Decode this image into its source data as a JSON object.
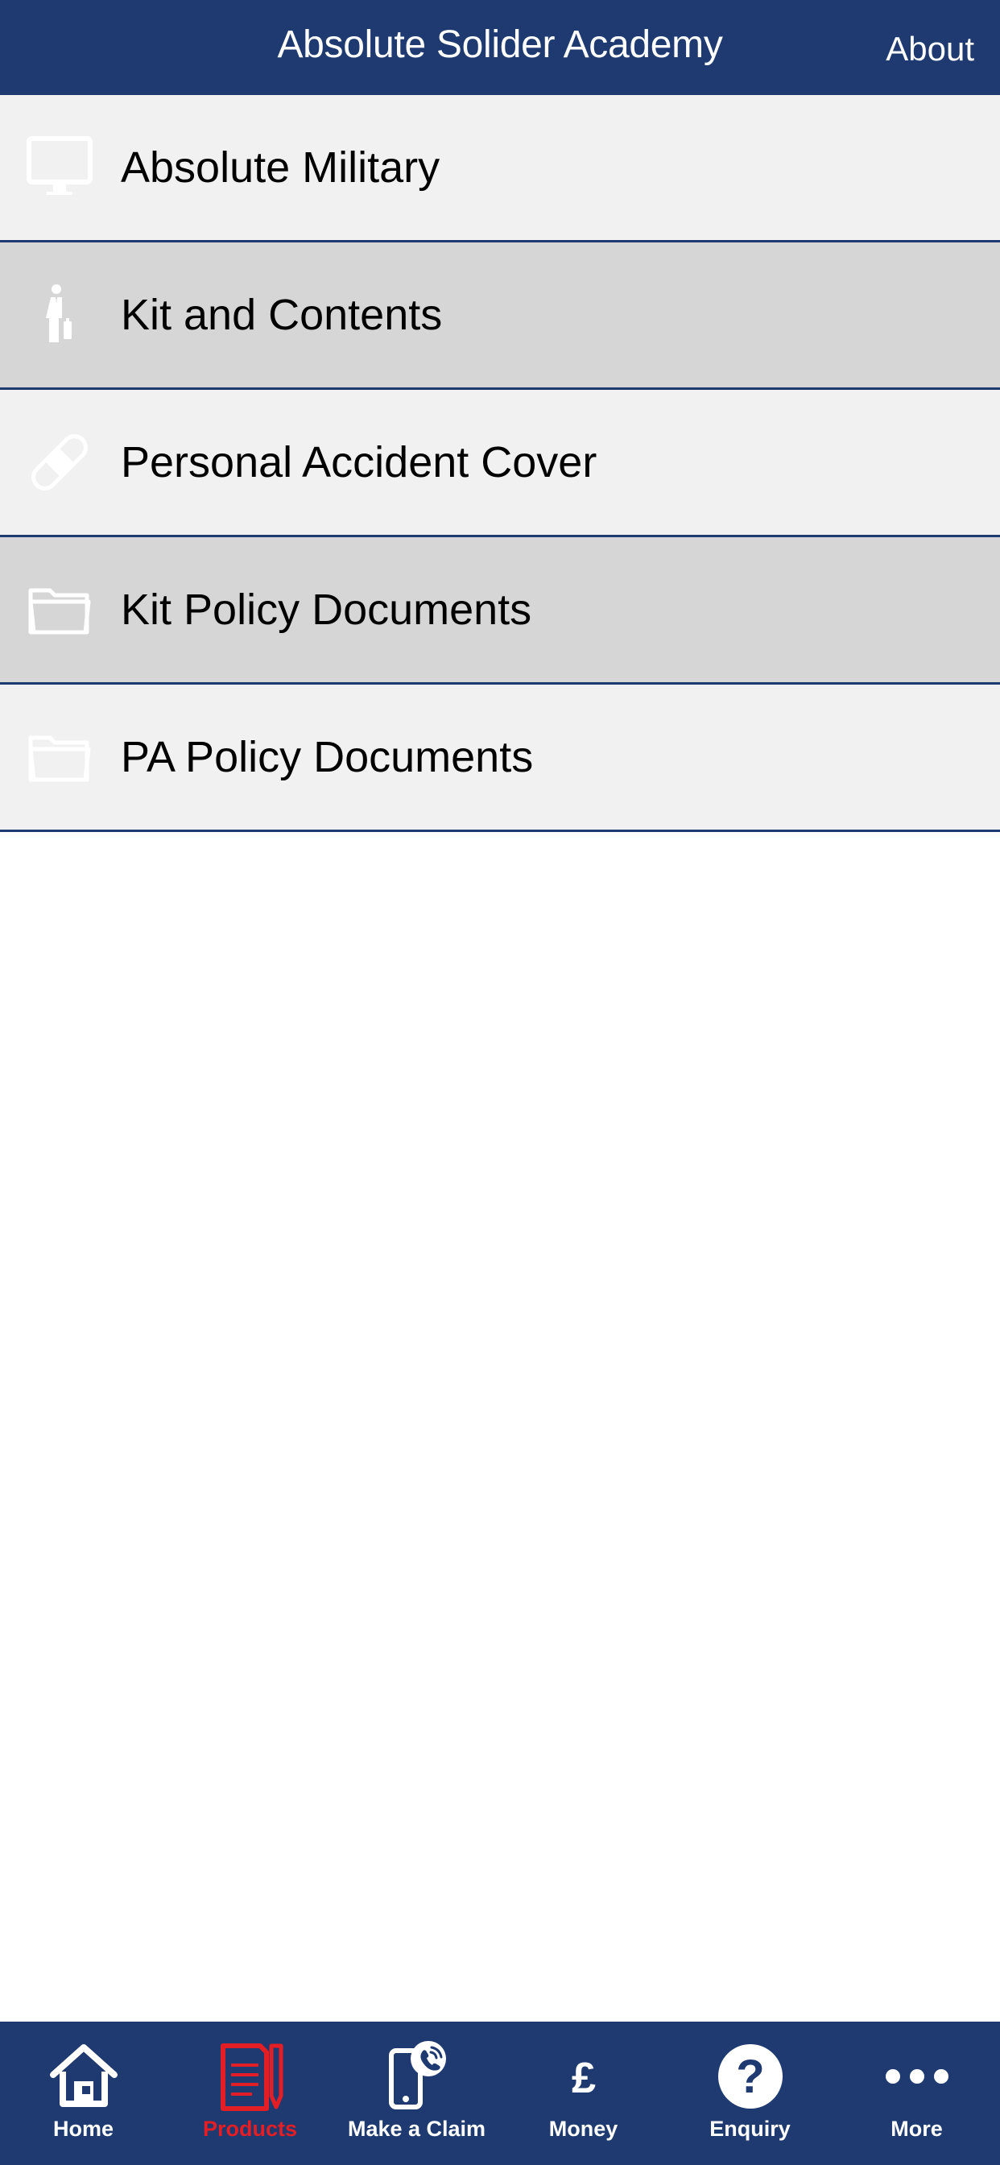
{
  "header": {
    "title": "Absolute Solider Academy",
    "about_label": "About"
  },
  "colors": {
    "brand": "#1e3a70",
    "row_light": "#f1f1f1",
    "row_dark": "#d6d6d6",
    "active_tab": "#e31e24"
  },
  "list": {
    "items": [
      {
        "label": "Absolute Military",
        "icon": "monitor-icon"
      },
      {
        "label": "Kit and Contents",
        "icon": "person-with-luggage-icon"
      },
      {
        "label": "Personal Accident Cover",
        "icon": "bandage-icon"
      },
      {
        "label": "Kit Policy Documents",
        "icon": "folder-icon"
      },
      {
        "label": "PA Policy Documents",
        "icon": "folder-icon"
      }
    ]
  },
  "tabbar": {
    "tabs": [
      {
        "label": "Home",
        "icon": "home-icon"
      },
      {
        "label": "Products",
        "icon": "document-pencil-icon",
        "active": true
      },
      {
        "label": "Make a Claim",
        "icon": "phone-call-icon"
      },
      {
        "label": "Money",
        "icon": "pound-icon"
      },
      {
        "label": "Enquiry",
        "icon": "question-icon"
      },
      {
        "label": "More",
        "icon": "more-dots-icon"
      }
    ]
  }
}
